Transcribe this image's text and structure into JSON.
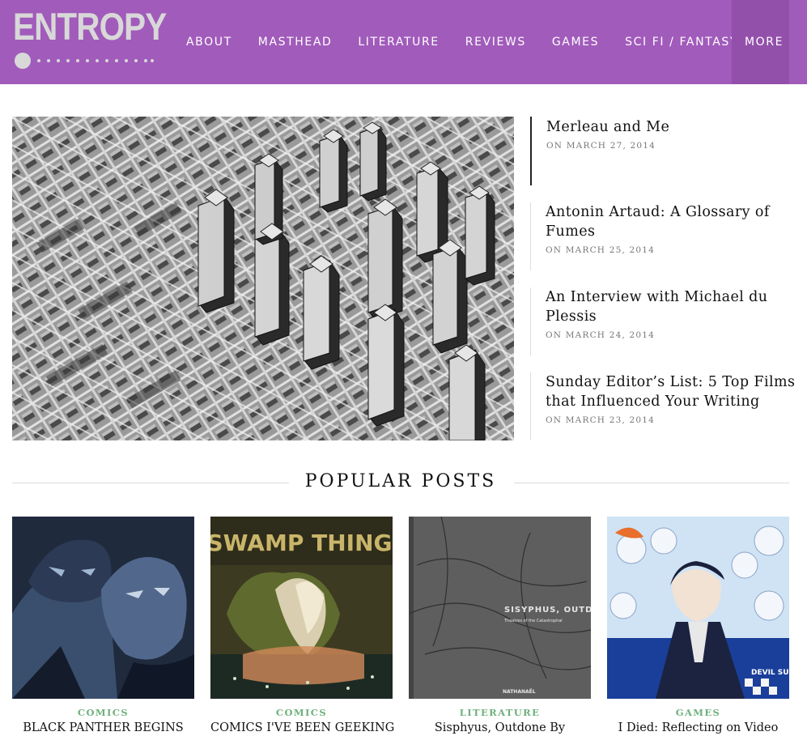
{
  "header": {
    "logo": "ENTROPY",
    "nav": [
      "ABOUT",
      "MASTHEAD",
      "LITERATURE",
      "REVIEWS",
      "GAMES",
      "SCI FI / FANTASY"
    ],
    "more": "MORE",
    "colors": {
      "bar": "#a15bbb",
      "more_bg": "#9350ab",
      "logo": "#d8d8d8"
    }
  },
  "recent_posts": [
    {
      "title": "Merleau and Me",
      "date": "ON MARCH 27, 2014"
    },
    {
      "title": "Antonin Artaud: A Glossary of Fumes",
      "date": "ON MARCH 25, 2014"
    },
    {
      "title": "An Interview with Michael du Plessis",
      "date": "ON MARCH 24, 2014"
    },
    {
      "title": "Sunday Editor’s List: 5 Top Films that Influenced Your Writing",
      "date": "ON MARCH 23, 2014"
    }
  ],
  "popular": {
    "heading": "POPULAR POSTS",
    "cards": [
      {
        "category": "COMICS",
        "title": "BLACK PANTHER BEGINS"
      },
      {
        "category": "COMICS",
        "title": "COMICS I'VE BEEN GEEKING"
      },
      {
        "category": "LITERATURE",
        "title": "Sisphyus, Outdone By"
      },
      {
        "category": "GAMES",
        "title": "I Died: Reflecting on Video"
      }
    ],
    "cover_text": {
      "swamp_thing": "SWAMP THING",
      "sisyphus": "SISYPHUS, OUTDONE.",
      "sisyphus_sub": "Theatres of the Catastrophal",
      "sisyphus_author": "NATHANAËL",
      "devil": "DEVIL SURVIVOR"
    },
    "category_color": "#6fb07c"
  }
}
